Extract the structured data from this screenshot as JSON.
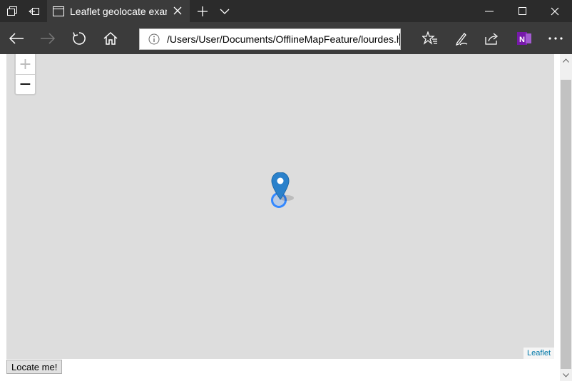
{
  "browser": {
    "tab_title": "Leaflet geolocate exam",
    "address": "/Users/User/Documents/OfflineMapFeature/lourdes.html"
  },
  "map": {
    "zoom_in": "+",
    "zoom_out": "−",
    "attribution": "Leaflet"
  },
  "page": {
    "locate_button": "Locate me!"
  },
  "colors": {
    "titlebar": "#2b2b2b",
    "navbar": "#3b3b3b",
    "map_bg": "#dddddd",
    "marker": "#2a81cb",
    "accuracy_circle": "#3388ff",
    "onenote": "#7719aa"
  }
}
